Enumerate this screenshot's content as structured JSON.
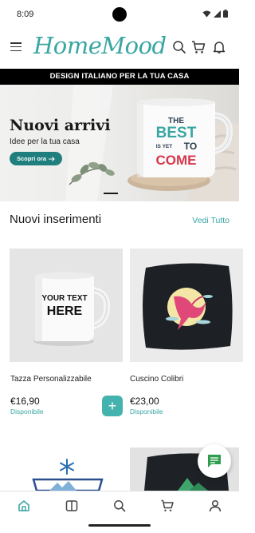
{
  "status_bar": {
    "time": "8:09"
  },
  "header": {
    "logo": "HomeMood",
    "menu_icon": "hamburger-menu-icon",
    "icons": [
      "search-icon",
      "cart-icon",
      "bell-icon"
    ]
  },
  "promo_strip": {
    "text": "DESIGN ITALIANO PER LA TUA CASA"
  },
  "hero": {
    "title": "Nuovi arrivi",
    "subtitle": "Idee per la tua casa",
    "cta_label": "Scopri ora",
    "mug_text": [
      "THE",
      "BEST",
      "IS YET",
      "TO",
      "COME"
    ]
  },
  "section": {
    "title": "Nuovi inserimenti",
    "view_all": "Vedi Tutto"
  },
  "products": [
    {
      "name": "Tazza Personalizzabile",
      "price": "€16,90",
      "availability": "Disponibile",
      "image_text": [
        "YOUR TEXT",
        "HERE"
      ]
    },
    {
      "name": "Cuscino Colibri",
      "price": "€23,00",
      "availability": "Disponibile"
    }
  ],
  "add_button_label": "+",
  "bottom_nav": [
    "home-icon",
    "book-icon",
    "search-icon",
    "cart-icon",
    "user-icon"
  ],
  "colors": {
    "accent": "#3aa6a3",
    "cta": "#1f7f7e",
    "add_button": "#45b3ad"
  }
}
